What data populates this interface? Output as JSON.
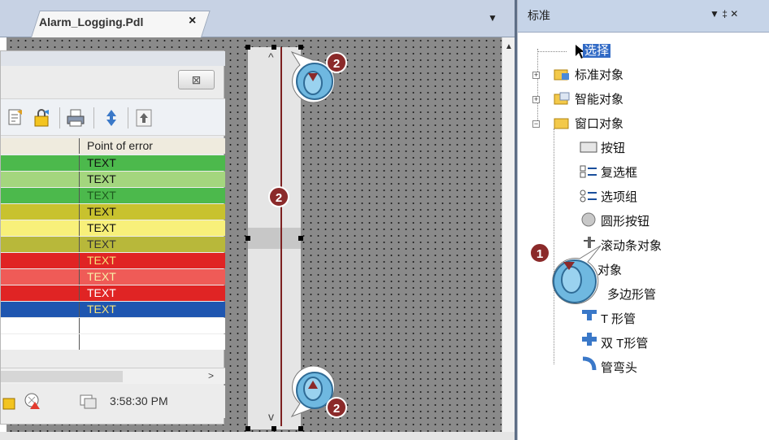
{
  "editor": {
    "tab_title": "Alarm_Logging.Pdl",
    "tab_close": "×",
    "tab_dropdown": "▼"
  },
  "alarm_control": {
    "close_button": "⊠",
    "column_header": "Point of error",
    "rows": [
      {
        "text": "TEXT",
        "bg": "#4cb94c",
        "fg": "#111111"
      },
      {
        "text": "TEXT",
        "bg": "#a4d67e",
        "fg": "#111111"
      },
      {
        "text": "TEXT",
        "bg": "#4cb94c",
        "fg": "#1e5a1e"
      },
      {
        "text": "TEXT",
        "bg": "#c8c22e",
        "fg": "#111111"
      },
      {
        "text": "TEXT",
        "bg": "#f8f07a",
        "fg": "#111111"
      },
      {
        "text": "TEXT",
        "bg": "#b8b83a",
        "fg": "#333333"
      },
      {
        "text": "TEXT",
        "bg": "#e02424",
        "fg": "#f6e27a"
      },
      {
        "text": "TEXT",
        "bg": "#ef5b57",
        "fg": "#f8f0a8"
      },
      {
        "text": "TEXT",
        "bg": "#e02424",
        "fg": "#ffffff"
      },
      {
        "text": "TEXT",
        "bg": "#1f56b0",
        "fg": "#f6e27a"
      },
      {
        "text": "",
        "bg": "#ffffff",
        "fg": "#111111"
      },
      {
        "text": "",
        "bg": "#ffffff",
        "fg": "#111111"
      }
    ],
    "time": "3:58:30 PM"
  },
  "callouts": [
    "2",
    "2",
    "2",
    "1"
  ],
  "panel": {
    "title": "标准",
    "pin": "▼ ‡ ✕",
    "tree": [
      {
        "label": "选择",
        "selected": true
      },
      {
        "label": "标准对象"
      },
      {
        "label": "智能对象"
      },
      {
        "label": "窗口对象"
      },
      {
        "label": "按钮"
      },
      {
        "label": "复选框"
      },
      {
        "label": "选项组"
      },
      {
        "label": "圆形按钮"
      },
      {
        "label": "滚动条对象"
      },
      {
        "label": "对象"
      },
      {
        "label": "多边形管"
      },
      {
        "label": "T 形管"
      },
      {
        "label": "双 T形管"
      },
      {
        "label": "管弯头"
      }
    ]
  },
  "colors": {
    "accent": "#316ac5",
    "callout_badge": "#8b2a2a",
    "callout_circle": "#6fb8e0"
  }
}
